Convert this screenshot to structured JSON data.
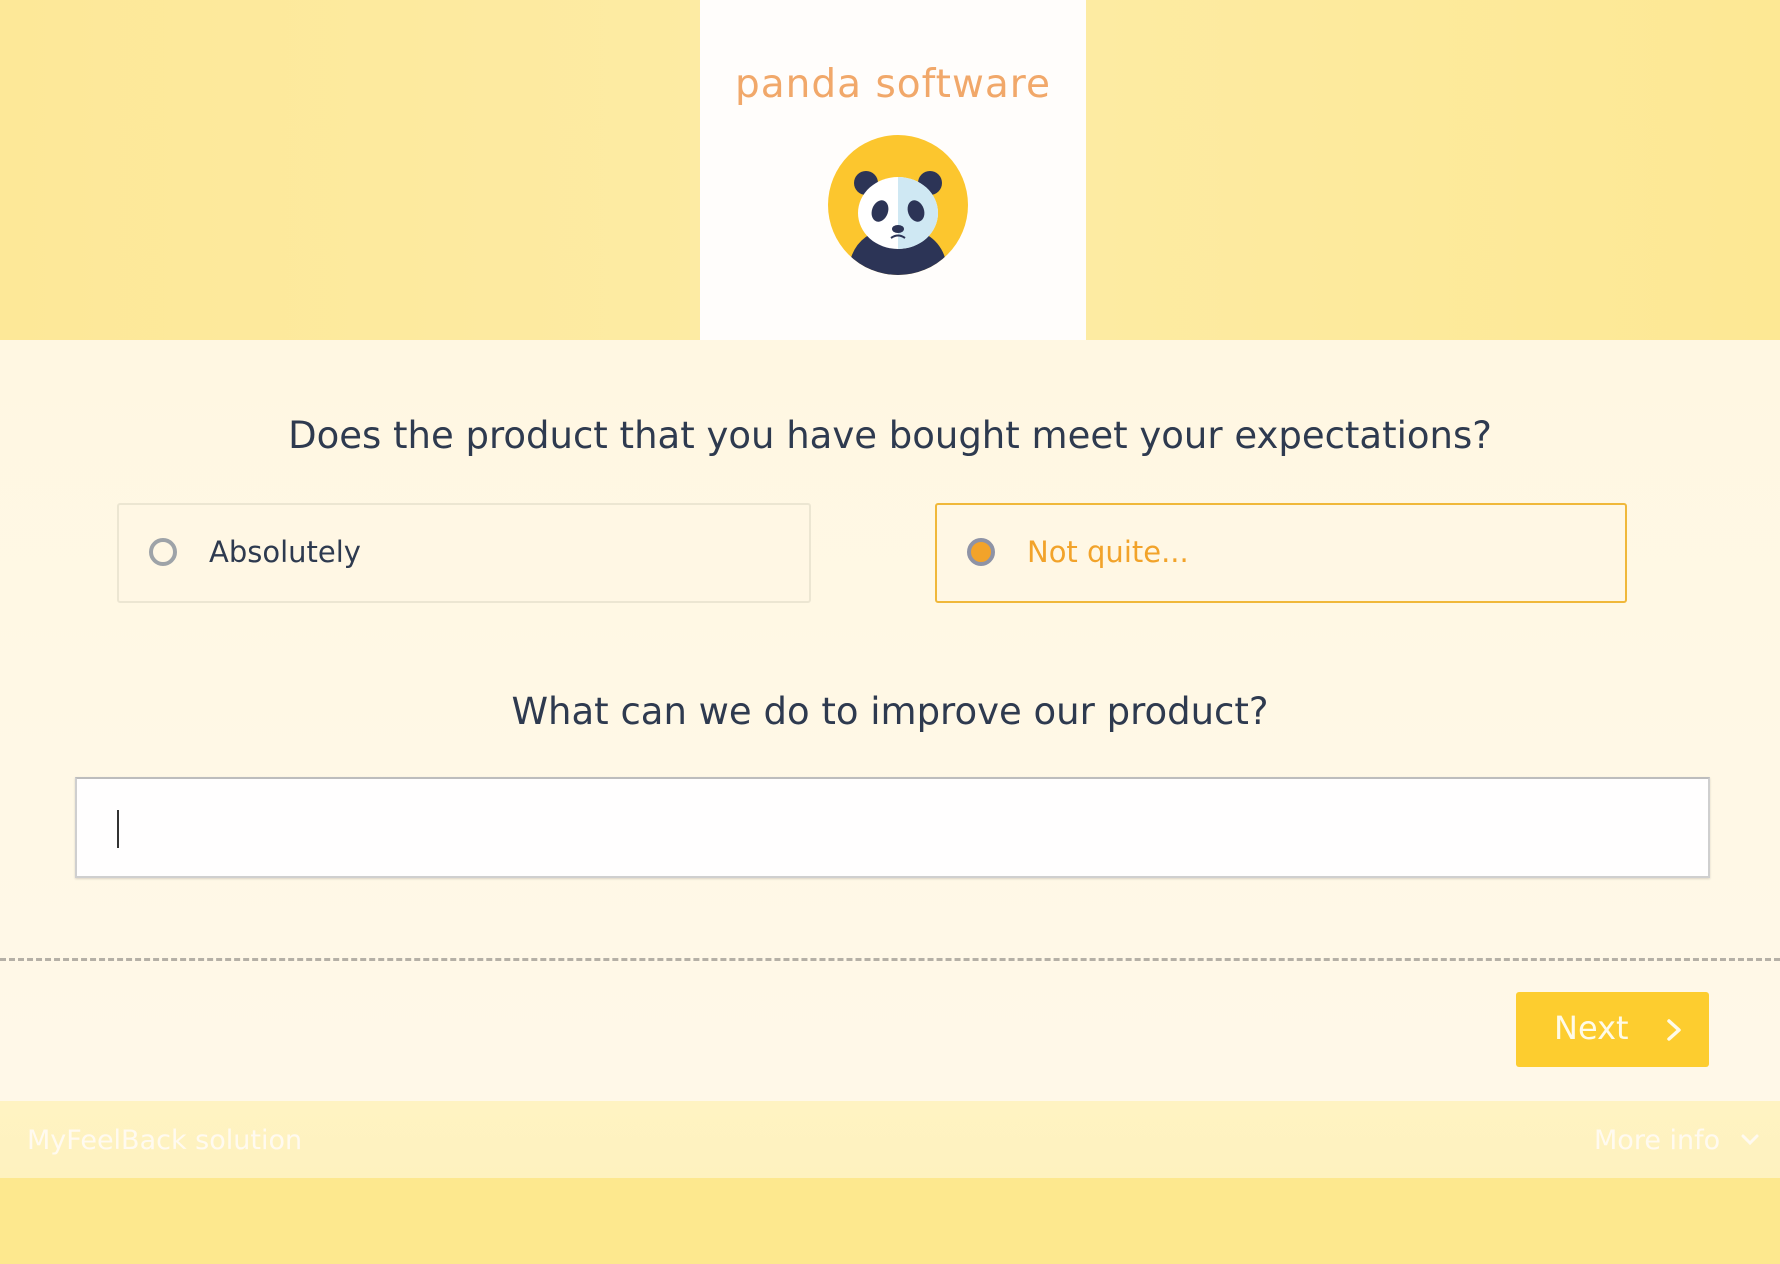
{
  "brand": {
    "name": "panda software",
    "logo_icon": "panda-face-icon",
    "colors": {
      "header_bg": "#fde898",
      "logo_text": "#f1a86a",
      "accent": "#f2a32a",
      "button": "#fdcd2f",
      "text": "#2e3a4f"
    }
  },
  "survey": {
    "question1": {
      "text": "Does the product that you have bought meet your expectations?",
      "options": [
        {
          "label": "Absolutely",
          "selected": false
        },
        {
          "label": "Not quite...",
          "selected": true
        }
      ]
    },
    "question2": {
      "text": "What can we do to improve our product?",
      "input_value": "",
      "placeholder": ""
    },
    "next_button": {
      "label": "Next",
      "icon": "chevron-right-icon"
    }
  },
  "footer": {
    "left_text": "MyFeelBack solution",
    "right_text": "More info",
    "right_icon": "chevron-down-icon"
  }
}
